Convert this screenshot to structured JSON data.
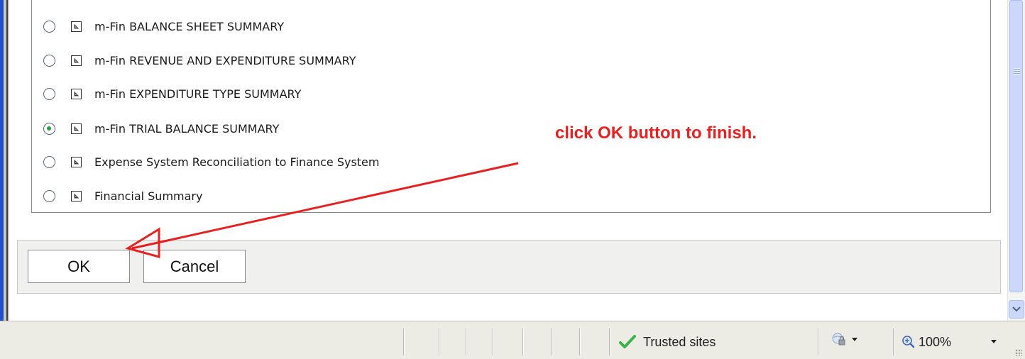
{
  "reports": [
    {
      "label": "m-Fin BALANCE SHEET SUMMARY",
      "selected": false,
      "icon": "report-icon"
    },
    {
      "label": "m-Fin REVENUE AND EXPENDITURE SUMMARY",
      "selected": false,
      "icon": "report-icon"
    },
    {
      "label": "m-Fin EXPENDITURE TYPE SUMMARY",
      "selected": false,
      "icon": "report-icon"
    },
    {
      "label": "m-Fin TRIAL BALANCE SUMMARY",
      "selected": true,
      "icon": "report-icon"
    },
    {
      "label": "Expense System Reconciliation to Finance System",
      "selected": false,
      "icon": "report-icon"
    },
    {
      "label": "Financial Summary",
      "selected": false,
      "icon": "report-icon"
    }
  ],
  "buttons": {
    "ok_label": "OK",
    "cancel_label": "Cancel"
  },
  "annotation": {
    "text": "click OK button to finish.",
    "color": "#e82020"
  },
  "status_bar": {
    "zone_label": "Trusted sites",
    "zone_icon": "green-check-icon",
    "protected_mode_icon": "globe-lock-icon",
    "zoom_label": "100%",
    "zoom_icon": "magnifier-plus-icon"
  },
  "colors": {
    "frame_blue": "#1f4fc9",
    "radio_selected": "#29a041"
  }
}
